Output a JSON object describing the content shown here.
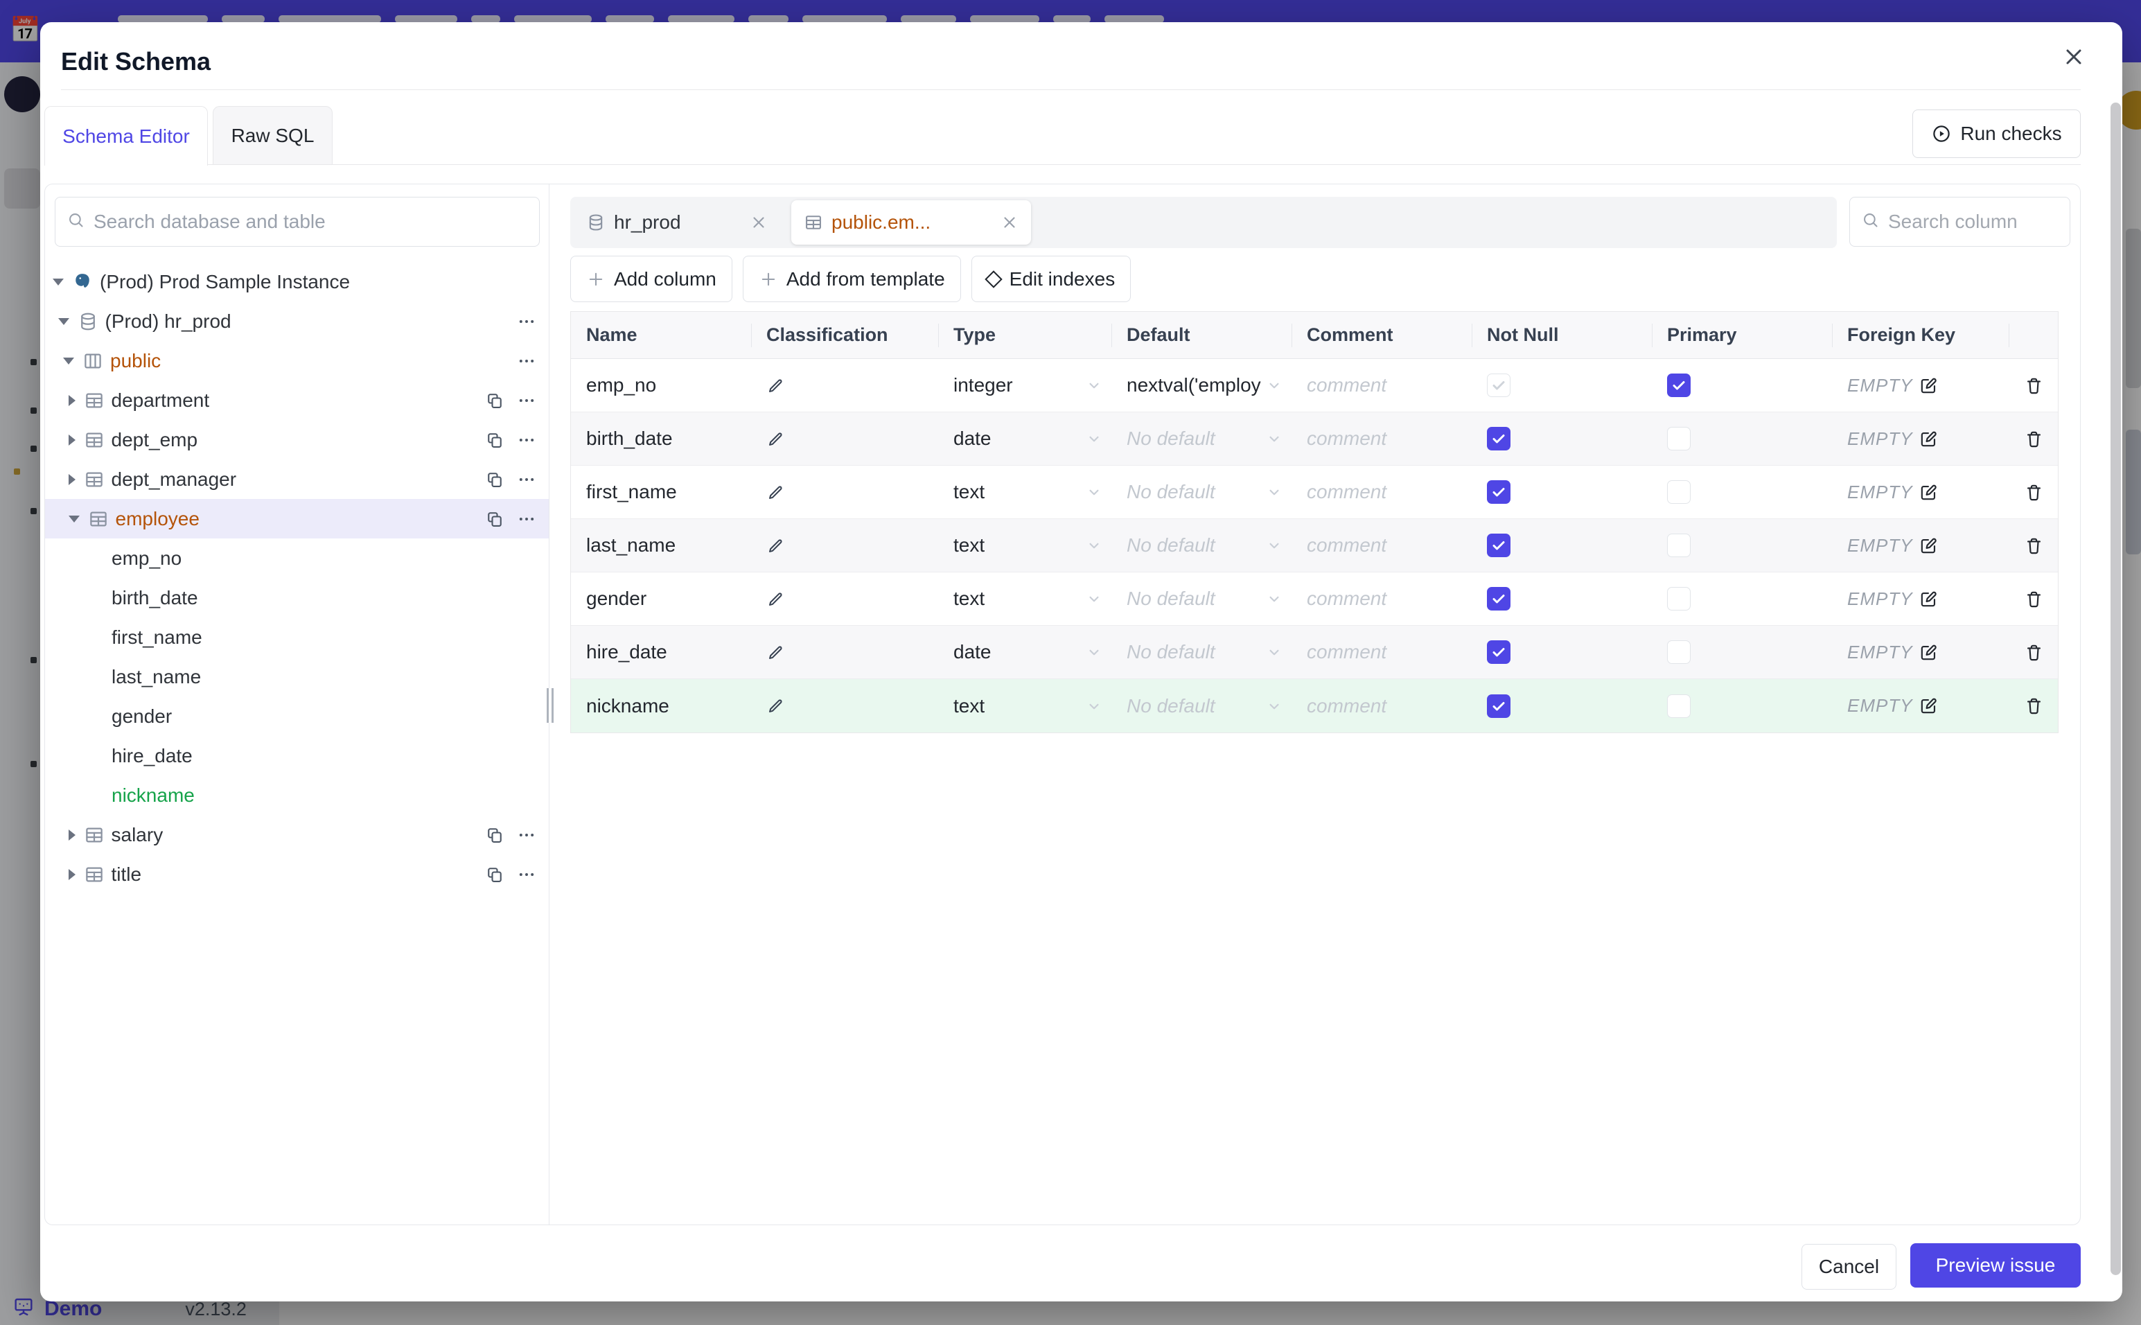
{
  "banner": {
    "emoji": "📅"
  },
  "page_footer": {
    "brand": "Demo",
    "version": "v2.13.2"
  },
  "modal": {
    "title": "Edit Schema",
    "tabs": [
      {
        "label": "Schema Editor",
        "active": true
      },
      {
        "label": "Raw SQL",
        "active": false
      }
    ],
    "run_checks_label": "Run checks",
    "sidebar": {
      "search_placeholder": "Search database and table",
      "tree": [
        {
          "label": "(Prod) Prod Sample Instance",
          "level": 0,
          "icon": "postgres",
          "caret": "down"
        },
        {
          "label": "(Prod) hr_prod",
          "level": 1,
          "icon": "database",
          "caret": "down",
          "actions": [
            "more"
          ]
        },
        {
          "label": "public",
          "level": 2,
          "icon": "schema",
          "caret": "down",
          "color": "amber",
          "actions": [
            "more"
          ]
        },
        {
          "label": "department",
          "level": 3,
          "icon": "table",
          "caret": "right",
          "actions": [
            "copy",
            "more"
          ]
        },
        {
          "label": "dept_emp",
          "level": 3,
          "icon": "table",
          "caret": "right",
          "actions": [
            "copy",
            "more"
          ]
        },
        {
          "label": "dept_manager",
          "level": 3,
          "icon": "table",
          "caret": "right",
          "actions": [
            "copy",
            "more"
          ]
        },
        {
          "label": "employee",
          "level": 3,
          "icon": "table",
          "caret": "down",
          "color": "amber",
          "selected": true,
          "actions": [
            "copy",
            "more"
          ]
        },
        {
          "label": "emp_no",
          "level": 4,
          "leaf": true
        },
        {
          "label": "birth_date",
          "level": 4,
          "leaf": true
        },
        {
          "label": "first_name",
          "level": 4,
          "leaf": true
        },
        {
          "label": "last_name",
          "level": 4,
          "leaf": true
        },
        {
          "label": "gender",
          "level": 4,
          "leaf": true
        },
        {
          "label": "hire_date",
          "level": 4,
          "leaf": true
        },
        {
          "label": "nickname",
          "level": 4,
          "leaf": true,
          "color": "green"
        },
        {
          "label": "salary",
          "level": 3,
          "icon": "table",
          "caret": "right",
          "actions": [
            "copy",
            "more"
          ]
        },
        {
          "label": "title",
          "level": 3,
          "icon": "table",
          "caret": "right",
          "actions": [
            "copy",
            "more"
          ]
        }
      ]
    },
    "editor": {
      "chips": [
        {
          "label": "hr_prod",
          "icon": "database",
          "active": false
        },
        {
          "label": "public.em...",
          "icon": "table",
          "active": true,
          "color": "amber"
        }
      ],
      "column_search_placeholder": "Search column",
      "toolbar": [
        {
          "label": "Add column",
          "icon": "plus"
        },
        {
          "label": "Add from template",
          "icon": "plus"
        },
        {
          "label": "Edit indexes",
          "icon": "diamond"
        }
      ],
      "table": {
        "columns": [
          "Name",
          "Classification",
          "Type",
          "Default",
          "Comment",
          "Not Null",
          "Primary",
          "Foreign Key",
          ""
        ],
        "comment_placeholder": "comment",
        "no_default_placeholder": "No default",
        "foreign_key_empty": "EMPTY",
        "rows": [
          {
            "name": "emp_no",
            "type": "integer",
            "default": "nextval('employ",
            "default_set": true,
            "not_null": "disabled-checked",
            "primary": "checked",
            "highlight": false
          },
          {
            "name": "birth_date",
            "type": "date",
            "default": "",
            "default_set": false,
            "not_null": "checked",
            "primary": "unchecked",
            "highlight": false
          },
          {
            "name": "first_name",
            "type": "text",
            "default": "",
            "default_set": false,
            "not_null": "checked",
            "primary": "unchecked",
            "highlight": false
          },
          {
            "name": "last_name",
            "type": "text",
            "default": "",
            "default_set": false,
            "not_null": "checked",
            "primary": "unchecked",
            "highlight": false
          },
          {
            "name": "gender",
            "type": "text",
            "default": "",
            "default_set": false,
            "not_null": "checked",
            "primary": "unchecked",
            "highlight": false
          },
          {
            "name": "hire_date",
            "type": "date",
            "default": "",
            "default_set": false,
            "not_null": "checked",
            "primary": "unchecked",
            "highlight": false
          },
          {
            "name": "nickname",
            "type": "text",
            "default": "",
            "default_set": false,
            "not_null": "checked",
            "primary": "unchecked",
            "highlight": true
          }
        ]
      }
    },
    "footer_actions": [
      {
        "label": "Cancel",
        "primary": false
      },
      {
        "label": "Preview issue",
        "primary": true
      }
    ]
  },
  "colors": {
    "accent": "#4f46e5",
    "banner": "#4f46e5",
    "changed_amber": "#b45309",
    "created_green": "#16a34a",
    "selected_row": "#ecebfa",
    "highlight_row": "#e9f8ef"
  }
}
